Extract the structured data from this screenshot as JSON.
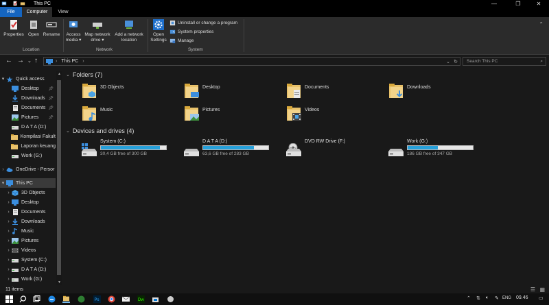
{
  "window": {
    "title": "This PC",
    "controls": [
      "—",
      "❐",
      "✕"
    ]
  },
  "ribbon_tabs": [
    "File",
    "Computer",
    "View"
  ],
  "ribbon": {
    "location": {
      "label": "Location",
      "buttons": [
        "Properties",
        "Open",
        "Rename"
      ]
    },
    "network": {
      "label": "Network",
      "access_media": [
        "Access",
        "media ▾"
      ],
      "map_drive": [
        "Map network",
        "drive ▾"
      ],
      "add_location": [
        "Add a network",
        "location"
      ]
    },
    "system": {
      "label": "System",
      "open_settings": [
        "Open",
        "Settings"
      ],
      "small_buttons": [
        "Uninstall or change a program",
        "System properties",
        "Manage"
      ]
    }
  },
  "address": {
    "path": "This PC",
    "search_placeholder": "Search This PC"
  },
  "nav": {
    "items": [
      {
        "label": "Quick access",
        "icon": "star-icon",
        "chev": "▾",
        "indent": 0
      },
      {
        "label": "Desktop",
        "icon": "desktop-icon",
        "pin": true,
        "indent": 1
      },
      {
        "label": "Downloads",
        "icon": "download-icon",
        "pin": true,
        "indent": 1
      },
      {
        "label": "Documents",
        "icon": "documents-icon",
        "pin": true,
        "indent": 1
      },
      {
        "label": "Pictures",
        "icon": "pictures-icon",
        "pin": true,
        "indent": 1
      },
      {
        "label": "D A T A (D:)",
        "icon": "drive-icon",
        "indent": 1
      },
      {
        "label": "Kompilasi Fakult",
        "icon": "folder-icon",
        "indent": 1
      },
      {
        "label": "Laporan keuang",
        "icon": "folder-icon",
        "indent": 1
      },
      {
        "label": "Work (G:)",
        "icon": "drive-icon",
        "indent": 1
      },
      {
        "label": "OneDrive - Persor",
        "icon": "cloud-icon",
        "chev": "›",
        "indent": 0,
        "gap": true
      },
      {
        "label": "This PC",
        "icon": "monitor-icon",
        "chev": "▾",
        "indent": 0,
        "gap": true,
        "selected": true
      },
      {
        "label": "3D Objects",
        "icon": "cube-icon",
        "chev": "›",
        "indent": 1
      },
      {
        "label": "Desktop",
        "icon": "desktop-icon",
        "chev": "›",
        "indent": 1
      },
      {
        "label": "Documents",
        "icon": "documents-icon",
        "chev": "›",
        "indent": 1
      },
      {
        "label": "Downloads",
        "icon": "download-icon",
        "chev": "›",
        "indent": 1
      },
      {
        "label": "Music",
        "icon": "music-icon",
        "chev": "›",
        "indent": 1
      },
      {
        "label": "Pictures",
        "icon": "pictures-icon",
        "chev": "›",
        "indent": 1
      },
      {
        "label": "Videos",
        "icon": "video-icon",
        "chev": "›",
        "indent": 1
      },
      {
        "label": "System (C:)",
        "icon": "drive-icon",
        "chev": "›",
        "indent": 1
      },
      {
        "label": "D A T A (D:)",
        "icon": "drive-icon",
        "chev": "›",
        "indent": 1
      },
      {
        "label": "Work (G:)",
        "icon": "drive-icon",
        "chev": "›",
        "indent": 1
      }
    ]
  },
  "folders": {
    "heading": "Folders (7)",
    "items": [
      {
        "name": "3D Objects",
        "icon": "folder-3d-icon"
      },
      {
        "name": "Desktop",
        "icon": "folder-desktop-icon"
      },
      {
        "name": "Documents",
        "icon": "folder-documents-icon"
      },
      {
        "name": "Downloads",
        "icon": "folder-downloads-icon"
      },
      {
        "name": "Music",
        "icon": "folder-music-icon"
      },
      {
        "name": "Pictures",
        "icon": "folder-pictures-icon"
      },
      {
        "name": "Videos",
        "icon": "folder-videos-icon"
      }
    ]
  },
  "drives": {
    "heading": "Devices and drives (4)",
    "items": [
      {
        "name": "System (C:)",
        "free": "30,4 GB free of 300 GB",
        "used_fraction": 0.9,
        "icon": "windows-drive-icon"
      },
      {
        "name": "D A T A (D:)",
        "free": "63,6 GB free of 283 GB",
        "used_fraction": 0.78,
        "icon": "hdd-icon"
      },
      {
        "name": "DVD RW Drive (F:)",
        "free": "",
        "used_fraction": null,
        "icon": "dvd-drive-icon"
      },
      {
        "name": "Work (G:)",
        "free": "186 GB free of 347 GB",
        "used_fraction": 0.46,
        "icon": "hdd-icon"
      }
    ]
  },
  "status": {
    "count": "11 items"
  },
  "taskbar": {
    "time": "09.46",
    "lang": "ENG"
  },
  "colors": {
    "accent": "#1565c0",
    "bar_fill": "#26a0da",
    "folder": "#e8c16a"
  }
}
